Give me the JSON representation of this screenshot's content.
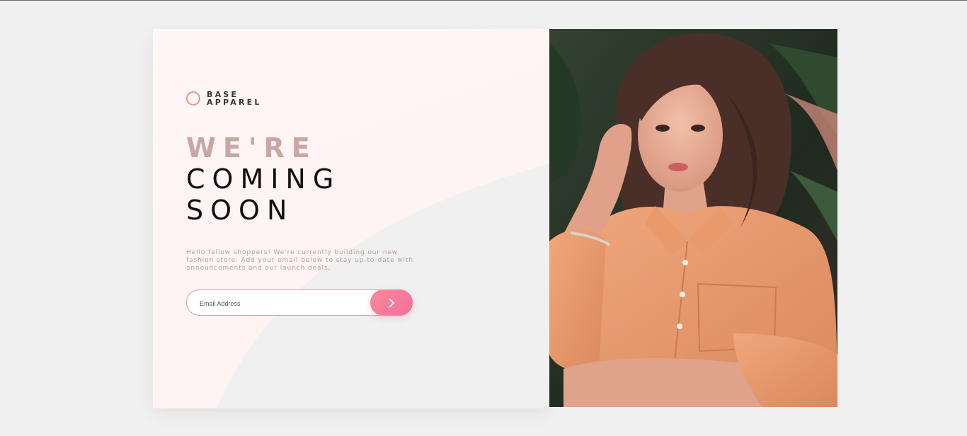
{
  "brand": {
    "line1": "BASE",
    "line2": "APPAREL"
  },
  "hero": {
    "line1": "WE'RE",
    "line2": "COMING",
    "line3": "SOON"
  },
  "description": "Hello fellow shoppers! We're currently building our new fashion store. Add your email below to stay up-to-date with announcements and our launch deals.",
  "form": {
    "email_placeholder": "Email Address",
    "submit_icon": "chevron-right-icon"
  },
  "colors": {
    "accent": "#f56f9c",
    "logo_ring": "#e8998e",
    "hero_light": "#c8a7a4",
    "text_desc": "#b69d9a",
    "shirt": "#e9996b"
  },
  "image": {
    "subject": "woman-in-orange-shirt-icon"
  }
}
